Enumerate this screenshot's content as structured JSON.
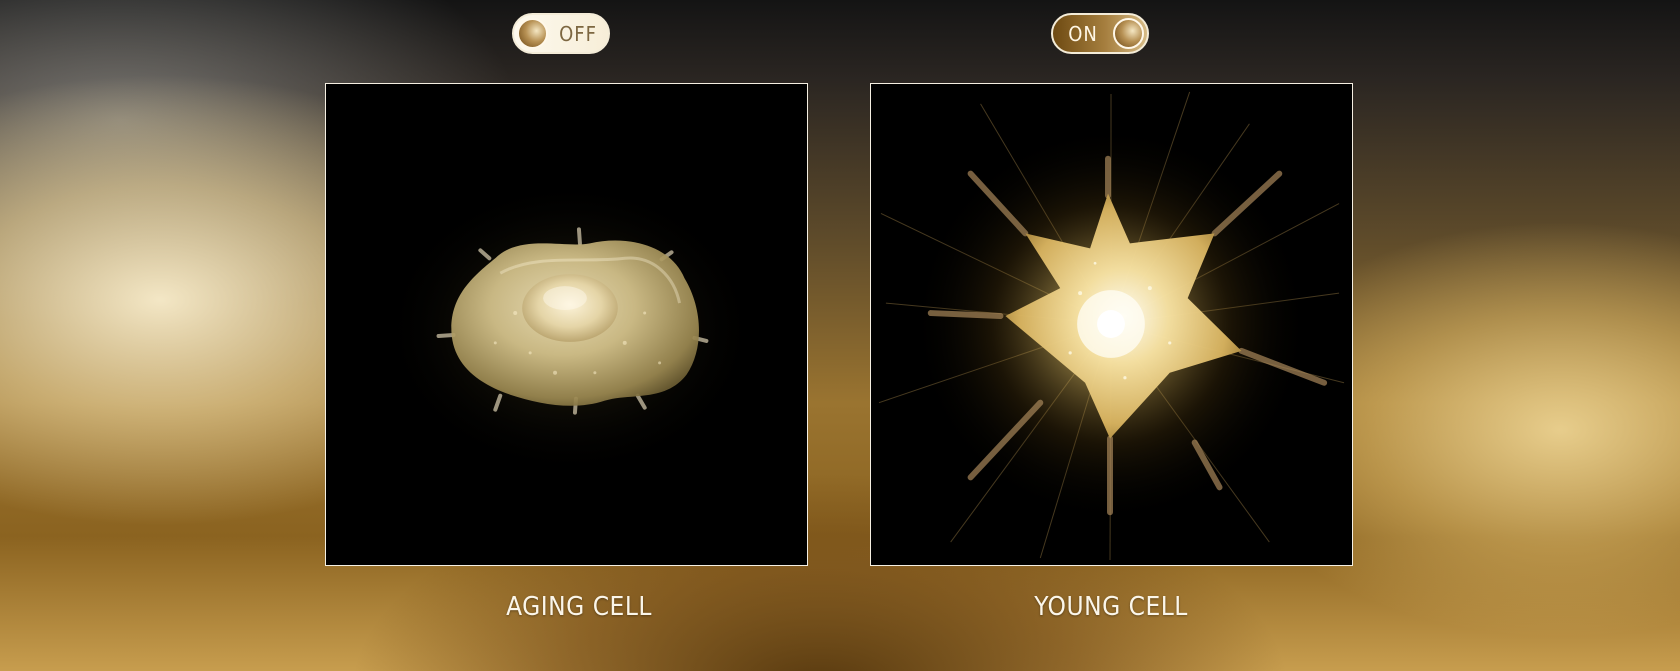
{
  "toggles": {
    "off": {
      "label": "OFF",
      "state": "off"
    },
    "on": {
      "label": "ON",
      "state": "on"
    }
  },
  "panels": {
    "left": {
      "caption": "AGING CELL"
    },
    "right": {
      "caption": "YOUNG CELL"
    }
  },
  "colors": {
    "gold_accent": "#a57e3e",
    "panel_border": "#f5efe2",
    "caption_text": "#fbf6ea"
  }
}
